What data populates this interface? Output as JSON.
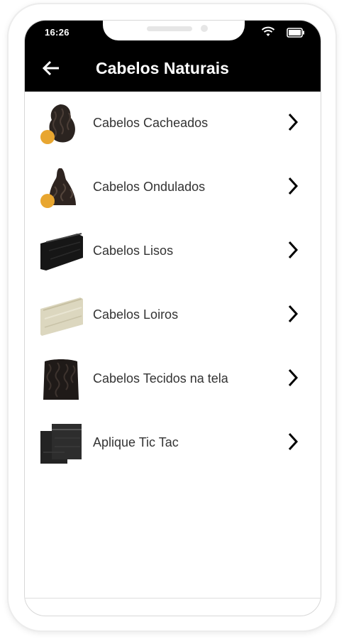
{
  "status_bar": {
    "time": "16:26"
  },
  "app_bar": {
    "title": "Cabelos Naturais"
  },
  "categories": [
    {
      "label": "Cabelos Cacheados",
      "thumb_icon": "curly-hair-bundle-icon"
    },
    {
      "label": "Cabelos Ondulados",
      "thumb_icon": "wavy-hair-bundle-icon"
    },
    {
      "label": "Cabelos Lisos",
      "thumb_icon": "straight-hair-weft-icon"
    },
    {
      "label": "Cabelos Loiros",
      "thumb_icon": "blonde-hair-weft-icon"
    },
    {
      "label": "Cabelos Tecidos na tela",
      "thumb_icon": "woven-hair-weft-icon"
    },
    {
      "label": "Aplique Tic Tac",
      "thumb_icon": "clip-in-extension-icon"
    }
  ],
  "colors": {
    "app_bar": "#000000",
    "text": "#333333",
    "background": "#ffffff"
  }
}
